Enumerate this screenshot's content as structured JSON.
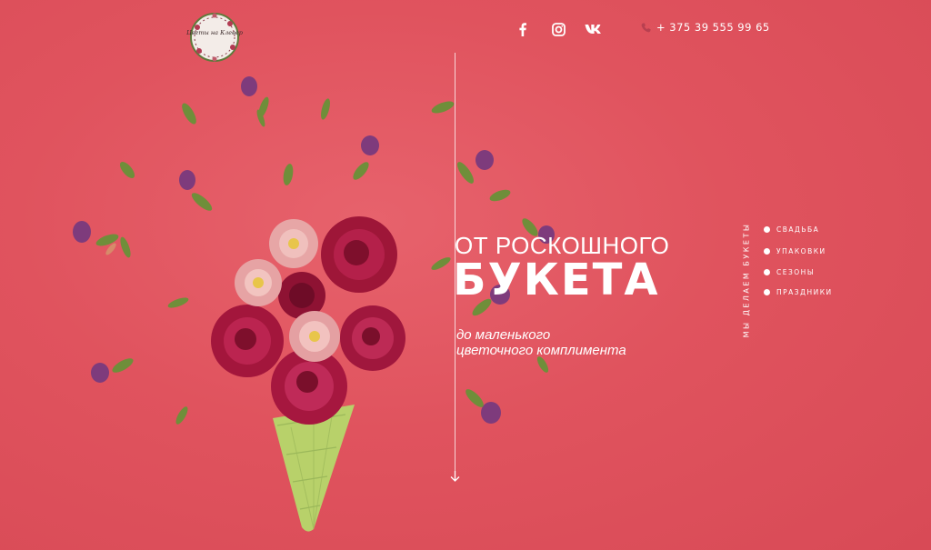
{
  "header": {
    "logo": {
      "text": "Цветы на Клевер",
      "alt": "logo"
    },
    "social": [
      {
        "name": "facebook-icon",
        "glyph": "f"
      },
      {
        "name": "instagram-icon",
        "glyph": ""
      },
      {
        "name": "vk-icon",
        "glyph": "vk"
      }
    ],
    "phone": "+ 375 39 555 99 65"
  },
  "hero": {
    "line1": "ОТ РОСКОШНОГО",
    "line2": "БУКЕТА",
    "subtitle_line1": "до маленького",
    "subtitle_line2": "цветочного комплимента"
  },
  "side": {
    "label": "МЫ ДЕЛАЕМ БУКЕТЫ",
    "items": [
      {
        "label": "СВАДЬБА"
      },
      {
        "label": "УПАКОВКИ"
      },
      {
        "label": "СЕЗОНЫ"
      },
      {
        "label": "ПРАЗДНИКИ"
      }
    ]
  },
  "colors": {
    "background": "#e0535e",
    "text": "#ffffff",
    "rose": "#a1193b",
    "pink": "#e8a4a3",
    "leaf": "#6f8e3a",
    "cone": "#b8d16a",
    "violet": "#7e3b7c"
  }
}
